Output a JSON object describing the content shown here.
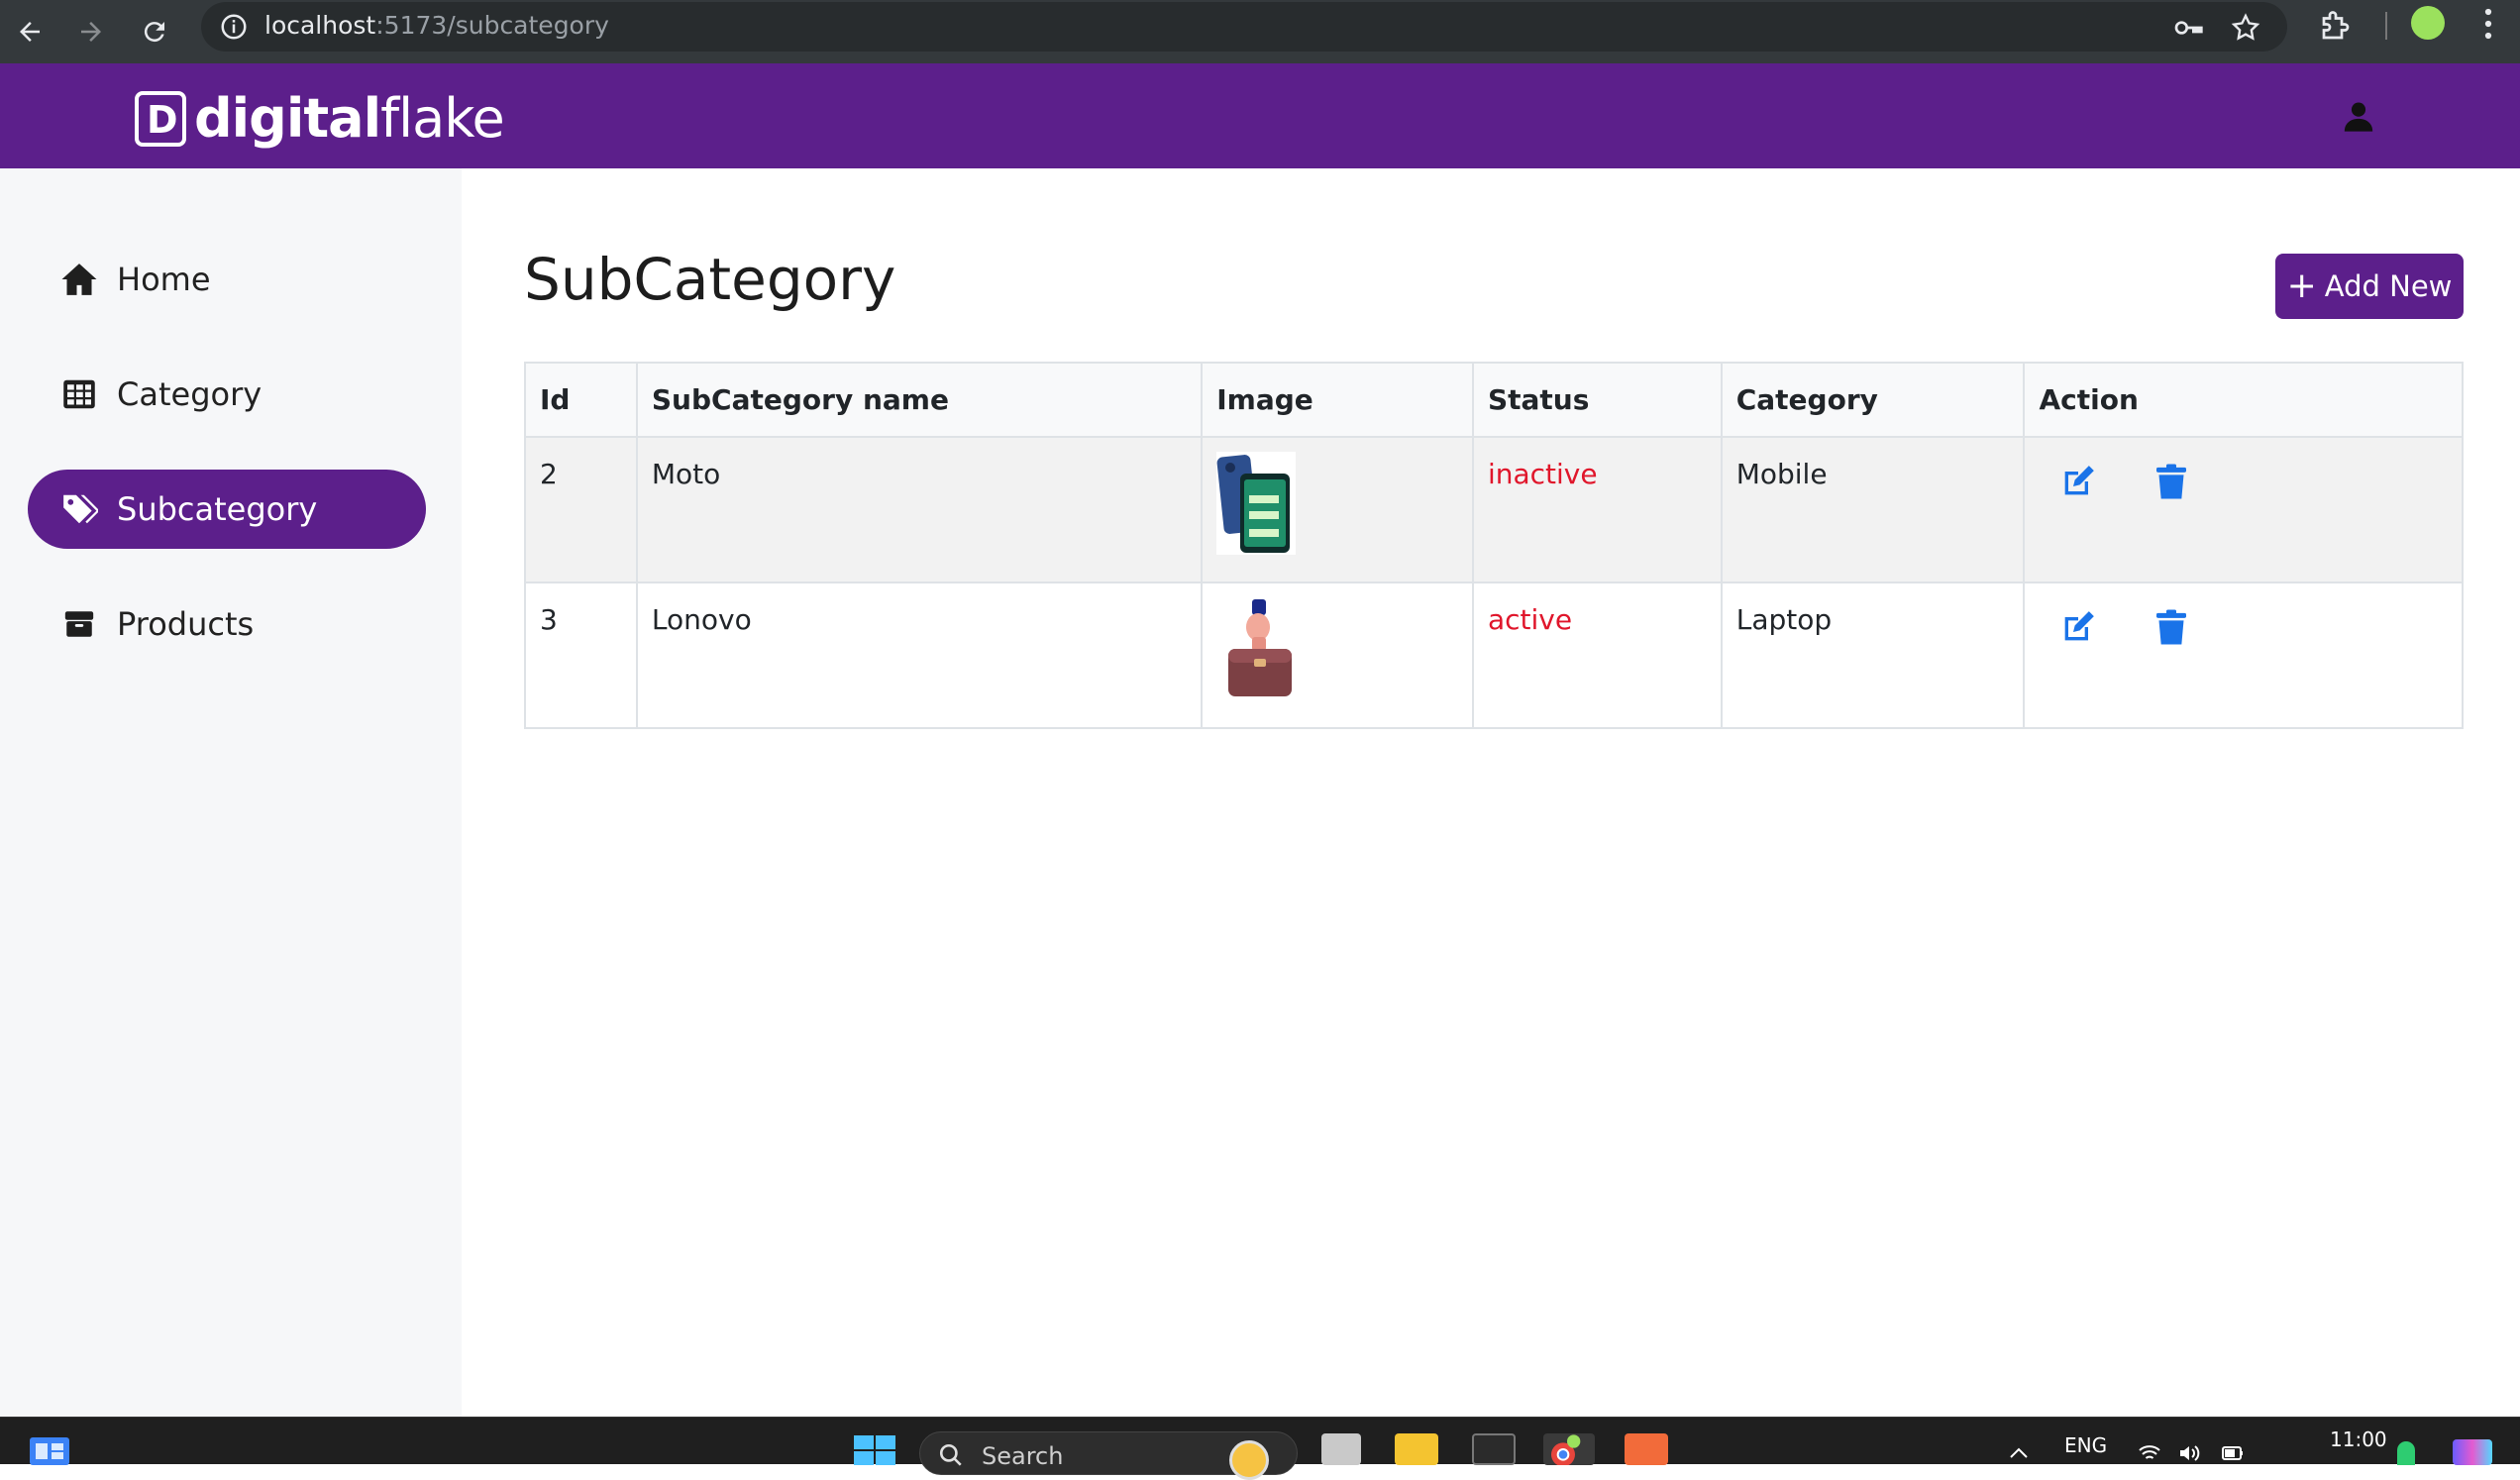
{
  "browser": {
    "url_host": "localhost",
    "url_path": ":5173/subcategory"
  },
  "app": {
    "logo_prefix": "digital",
    "logo_suffix": "flake",
    "logo_mark": "D"
  },
  "sidebar": {
    "items": [
      {
        "label": "Home",
        "icon": "home-icon",
        "active": false
      },
      {
        "label": "Category",
        "icon": "grid-icon",
        "active": false
      },
      {
        "label": "Subcategory",
        "icon": "tag-icon",
        "active": true
      },
      {
        "label": "Products",
        "icon": "box-icon",
        "active": false
      }
    ]
  },
  "main": {
    "title": "SubCategory",
    "add_label": "Add New",
    "table": {
      "headers": [
        "Id",
        "SubCategory name",
        "Image",
        "Status",
        "Category",
        "Action"
      ],
      "rows": [
        {
          "id": "2",
          "name": "Moto",
          "image": "phone-image",
          "status": "inactive",
          "category": "Mobile"
        },
        {
          "id": "3",
          "name": "Lonovo",
          "image": "briefcase-image",
          "status": "active",
          "category": "Laptop"
        }
      ]
    }
  },
  "taskbar": {
    "search_placeholder": "Search",
    "lang": "ENG",
    "time": "11:00"
  },
  "colors": {
    "brand": "#5c1f8b",
    "status": "#e0162b",
    "action_icons": "#1a73e8"
  }
}
